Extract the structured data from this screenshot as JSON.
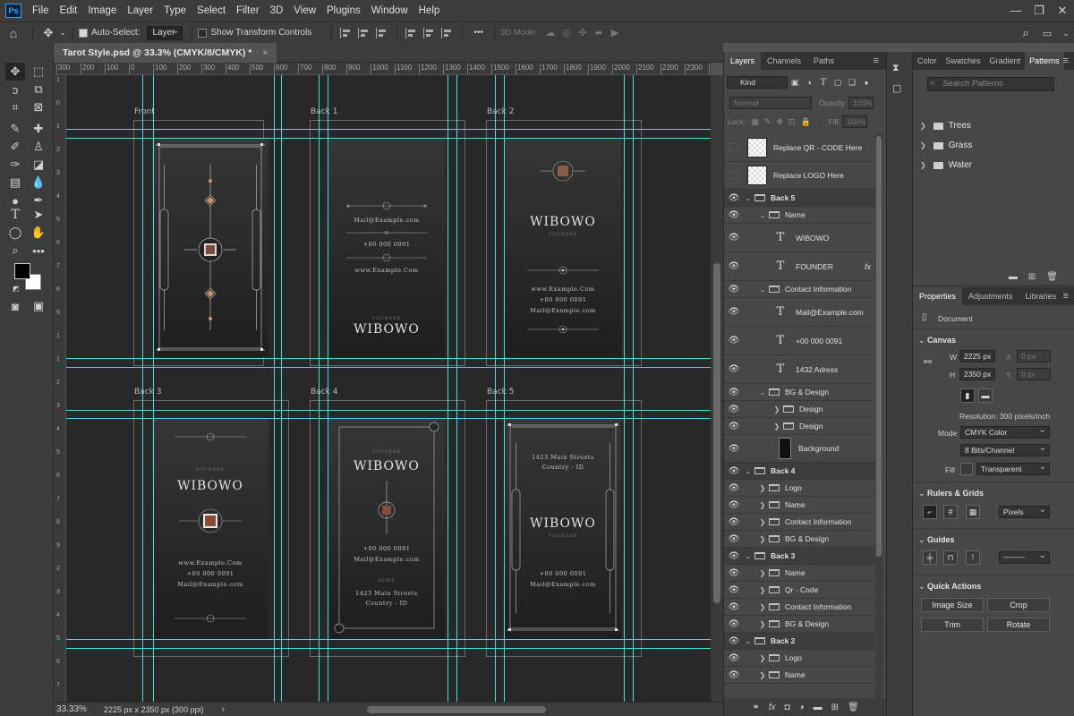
{
  "menubar": {
    "logo": "Ps",
    "items": [
      "File",
      "Edit",
      "Image",
      "Layer",
      "Type",
      "Select",
      "Filter",
      "3D",
      "View",
      "Plugins",
      "Window",
      "Help"
    ],
    "window_controls": [
      "—",
      "❐",
      "✕"
    ]
  },
  "options": {
    "auto_select_label": "Auto-Select:",
    "auto_select_value": "Layer",
    "transform_label": "Show Transform Controls",
    "mode_3d_label": "3D Mode:",
    "more": "•••"
  },
  "document": {
    "tab_title": "Tarot Style.psd @ 33.3% (CMYK/8/CMYK) *",
    "close": "×",
    "ruler_h": [
      "300",
      "200",
      "100",
      "0",
      "100",
      "200",
      "300",
      "400",
      "500",
      "600",
      "700",
      "800",
      "900",
      "1000",
      "1100",
      "1200",
      "1300",
      "1400",
      "1500",
      "1600",
      "1700",
      "1800",
      "1900",
      "2000",
      "2100",
      "2200",
      "2300",
      "2400"
    ],
    "ruler_v": [
      "1",
      "0",
      "1",
      "2",
      "3",
      "4",
      "5",
      "6",
      "7",
      "8",
      "9",
      "1",
      "1",
      "2",
      "3",
      "4",
      "5",
      "6",
      "7",
      "8",
      "9",
      "2",
      "3",
      "4",
      "5",
      "6",
      "7",
      "8"
    ]
  },
  "cards": {
    "labels": [
      "Front",
      "Back 1",
      "Back 2",
      "Back 3",
      "Back 4",
      "Back 5"
    ],
    "back1": {
      "mail": "Mail@Example.com",
      "phone": "+00 000  0091",
      "web": "www.Example.Com",
      "founder": "FOUNDER",
      "name": "WIBOWO"
    },
    "back2": {
      "name": "WIBOWO",
      "founder": "FOUNDER",
      "web": "www.Example.Com",
      "phone": "+00 000  0091",
      "mail": "Mail@Example.com"
    },
    "back3": {
      "founder": "FOUNDER",
      "name": "WIBOWO",
      "web": "www.Example.Com",
      "phone": "+00 000  0091",
      "mail": "Mail@Example.com"
    },
    "back4": {
      "founder": "FOUNDER",
      "name": "WIBOWO",
      "phone": "+00 000  0091",
      "mail": "Mail@Example.com",
      "addr_label": "HOME",
      "addr1": "1423 Main Streets",
      "addr2": "Country - ID"
    },
    "back5": {
      "addr1": "1423 Main Streets",
      "addr2": "Country - ID",
      "name": "WIBOWO",
      "founder": "FOUNDER",
      "phone": "+00 000  0091",
      "mail": "Mail@Example.com"
    }
  },
  "status": {
    "zoom": "33.33%",
    "doc_size": "2225 px x 2350 px (300 ppi)",
    "arrow": "›"
  },
  "layers_panel": {
    "tabs": [
      "Layers",
      "Channels",
      "Paths"
    ],
    "filter_kind": "Kind",
    "blend_mode": "Normal",
    "opacity_label": "Opacity:",
    "opacity_value": "100%",
    "lock_label": "Lock:",
    "fill_label": "Fill:",
    "fill_value": "100%",
    "fx": "fx",
    "rows": [
      {
        "type": "smart",
        "name": "Replace QR - CODE Here",
        "eye": false
      },
      {
        "type": "smart",
        "name": "Replace LOGO Here",
        "eye": false
      },
      {
        "type": "group",
        "name": "Back 5",
        "open": true,
        "indent": 0
      },
      {
        "type": "folder",
        "name": "Name",
        "open": true,
        "indent": 1
      },
      {
        "type": "text",
        "name": "WIBOWO",
        "indent": 2
      },
      {
        "type": "text",
        "name": "FOUNDER",
        "indent": 2,
        "fx": true
      },
      {
        "type": "folder",
        "name": "Contact Information",
        "open": true,
        "indent": 1
      },
      {
        "type": "text",
        "name": "Mail@Example.com",
        "indent": 2
      },
      {
        "type": "text",
        "name": "+00 000  0091",
        "indent": 2
      },
      {
        "type": "text",
        "name": "1432 Adress",
        "indent": 2
      },
      {
        "type": "folder",
        "name": "BG & Design",
        "open": true,
        "indent": 1
      },
      {
        "type": "folder",
        "name": "Design",
        "open": false,
        "indent": 2
      },
      {
        "type": "folder",
        "name": "Design",
        "open": false,
        "indent": 2
      },
      {
        "type": "bg",
        "name": "Background",
        "indent": 2
      },
      {
        "type": "group",
        "name": "Back 4",
        "open": true,
        "indent": 0
      },
      {
        "type": "folder",
        "name": "Logo",
        "open": false,
        "indent": 1
      },
      {
        "type": "folder",
        "name": "Name",
        "open": false,
        "indent": 1
      },
      {
        "type": "folder",
        "name": "Contact Information",
        "open": false,
        "indent": 1
      },
      {
        "type": "folder",
        "name": "BG & Design",
        "open": false,
        "indent": 1
      },
      {
        "type": "group",
        "name": "Back 3",
        "open": true,
        "indent": 0
      },
      {
        "type": "folder",
        "name": "Name",
        "open": false,
        "indent": 1
      },
      {
        "type": "folder",
        "name": "Qr - Code",
        "open": false,
        "indent": 1
      },
      {
        "type": "folder",
        "name": "Contact Information",
        "open": false,
        "indent": 1
      },
      {
        "type": "folder",
        "name": "BG & Design",
        "open": false,
        "indent": 1
      },
      {
        "type": "group",
        "name": "Back 2",
        "open": true,
        "indent": 0
      },
      {
        "type": "folder",
        "name": "Logo",
        "open": false,
        "indent": 1
      },
      {
        "type": "folder",
        "name": "Name",
        "open": false,
        "indent": 1
      }
    ]
  },
  "patterns_panel": {
    "tabs": [
      "Color",
      "Swatches",
      "Gradient",
      "Patterns"
    ],
    "search_placeholder": "Search Patterns",
    "folders": [
      "Trees",
      "Grass",
      "Water"
    ]
  },
  "properties": {
    "tabs": [
      "Properties",
      "Adjustments",
      "Libraries"
    ],
    "kind": "Document",
    "canvas_title": "Canvas",
    "w_label": "W",
    "w_value": "2225 px",
    "h_label": "H",
    "h_value": "2350 px",
    "x_label": "X",
    "x_value": "0 px",
    "y_label": "Y",
    "y_value": "0 px",
    "resolution": "Resolution: 300 pixels/inch",
    "mode_label": "Mode",
    "mode_value": "CMYK Color",
    "bits_value": "8 Bits/Channel",
    "fill_label": "Fill",
    "fill_value": "Transparent",
    "rulers_title": "Rulers & Grids",
    "units_value": "Pixels",
    "guides_title": "Guides",
    "quick_title": "Quick Actions",
    "btn_image_size": "Image Size",
    "btn_crop": "Crop",
    "btn_trim": "Trim",
    "btn_rotate": "Rotate"
  }
}
